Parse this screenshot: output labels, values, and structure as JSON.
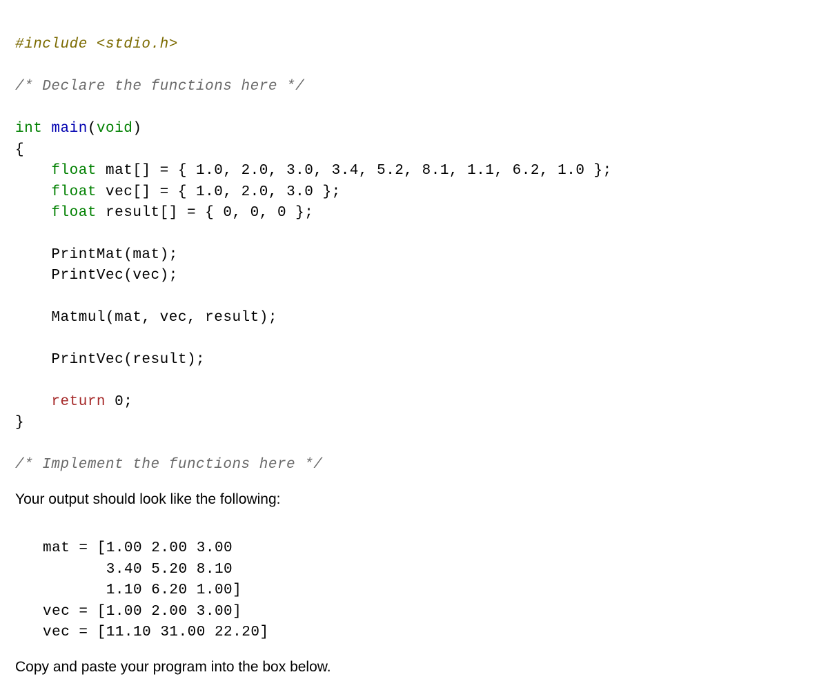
{
  "code": {
    "include": "#include <stdio.h>",
    "comment_declare": "/* Declare the functions here */",
    "sig_int": "int",
    "sig_main": "main",
    "sig_void": "void",
    "brace_open": "{",
    "float_kw": "float",
    "mat_line_rest": " mat[] = { 1.0, 2.0, 3.0, 3.4, 5.2, 8.1, 1.1, 6.2, 1.0 };",
    "vec_line_rest": " vec[] = { 1.0, 2.0, 3.0 };",
    "result_line_rest": " result[] = { 0, 0, 0 };",
    "printmat": "    PrintMat(mat);",
    "printvec1": "    PrintVec(vec);",
    "matmul": "    Matmul(mat, vec, result);",
    "printvec2": "    PrintVec(result);",
    "return_kw": "return",
    "return_rest": " 0;",
    "brace_close": "}",
    "comment_impl": "/* Implement the functions here */"
  },
  "prose": {
    "intro": "Your output should look like the following:",
    "outro": "Copy and paste your program into the box below."
  },
  "output": {
    "l1": "mat = [1.00 2.00 3.00",
    "l2": "       3.40 5.20 8.10",
    "l3": "       1.10 6.20 1.00]",
    "l4": "vec = [1.00 2.00 3.00]",
    "l5": "vec = [11.10 31.00 22.20]"
  }
}
